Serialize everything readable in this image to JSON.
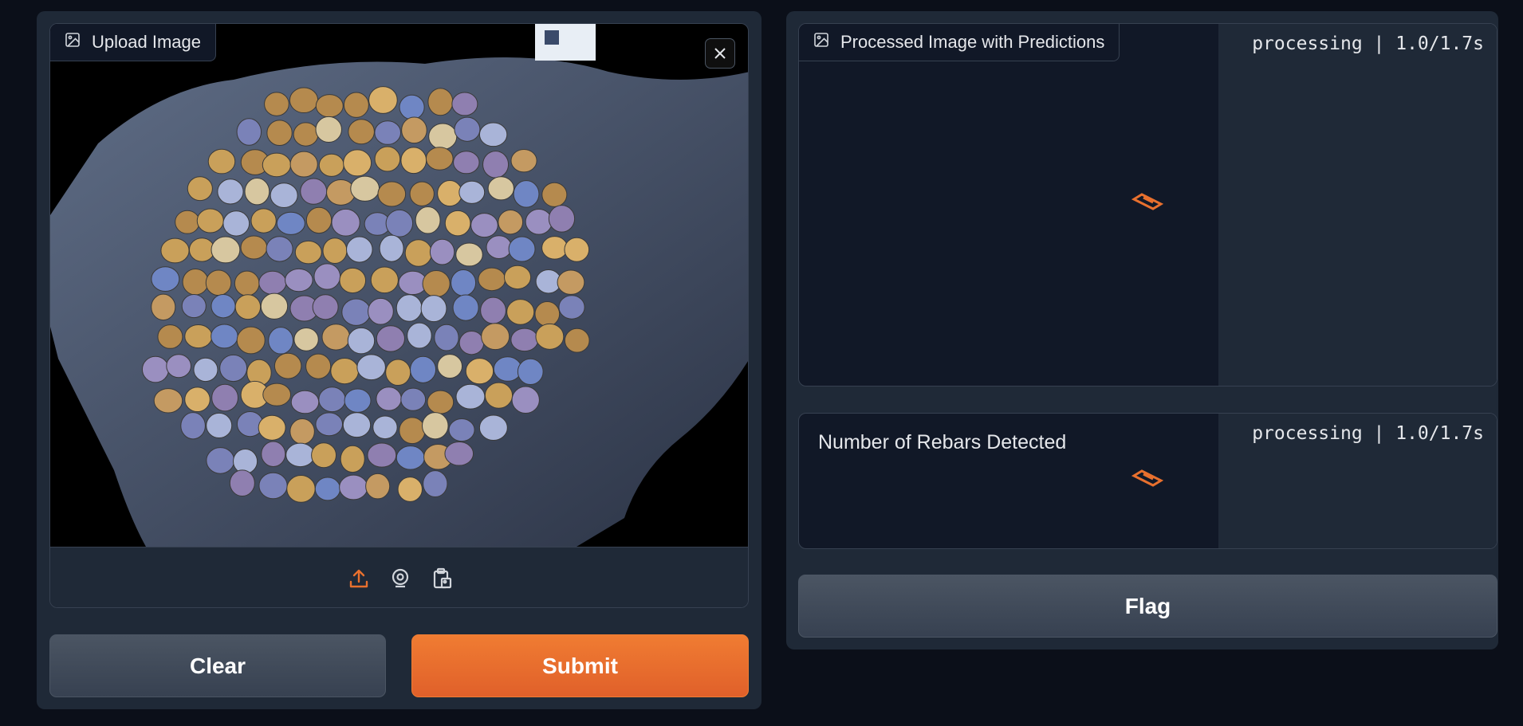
{
  "upload": {
    "label": "Upload Image",
    "image_alt": "Bundle of rebar ends",
    "sources": [
      "upload-icon",
      "webcam-icon",
      "clipboard-icon"
    ]
  },
  "buttons": {
    "clear": "Clear",
    "submit": "Submit",
    "flag": "Flag"
  },
  "output_image": {
    "label": "Processed Image with Predictions",
    "status": "processing | 1.0/1.7s"
  },
  "output_count": {
    "label": "Number of Rebars Detected",
    "status": "processing | 1.0/1.7s"
  },
  "colors": {
    "accent": "#e8702e",
    "background": "#0b0f19",
    "panel": "#1f2937",
    "block": "#111827"
  }
}
